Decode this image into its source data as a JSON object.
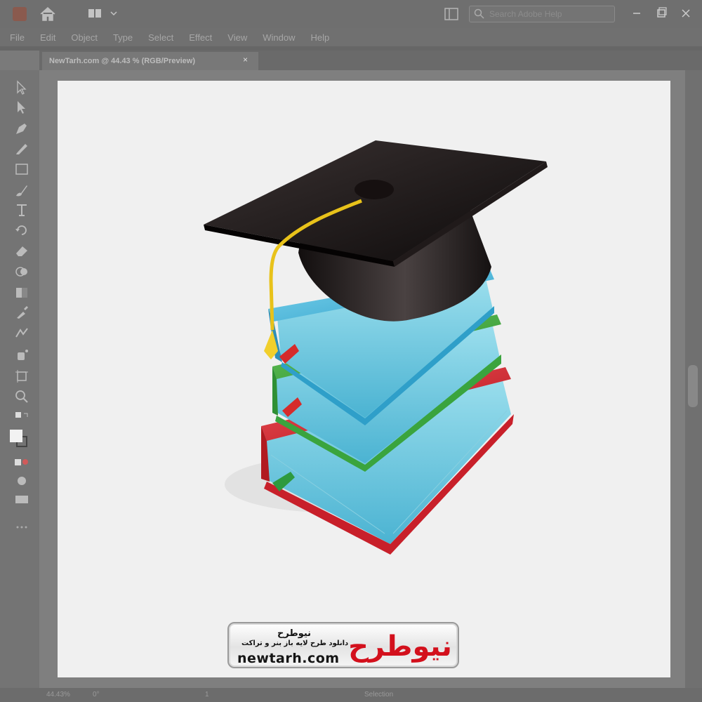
{
  "titlebar": {
    "search_placeholder": "Search Adobe Help",
    "icons": [
      "app-logo",
      "home-icon",
      "workspace-switcher-icon",
      "arrange-documents-icon",
      "search-icon",
      "minimize-icon",
      "maximize-icon",
      "close-icon"
    ]
  },
  "menu": [
    "File",
    "Edit",
    "Object",
    "Type",
    "Select",
    "Effect",
    "View",
    "Window",
    "Help"
  ],
  "tab": {
    "title": "NewTarh.com @ 44.43 % (RGB/Preview)",
    "close": "×"
  },
  "tools": [
    "selection-tool",
    "direct-selection-tool",
    "pen-tool",
    "pencil-tool",
    "rectangle-tool",
    "paintbrush-tool",
    "type-tool",
    "rotate-tool",
    "eraser-tool",
    "shape-builder-tool",
    "gradient-tool",
    "eyedropper-tool",
    "blend-tool",
    "symbol-sprayer-tool",
    "artboard-tool",
    "zoom-tool",
    "fill-stroke-swap",
    "fill-swatch",
    "color-mode",
    "drawing-mode",
    "screen-mode",
    "more-tools"
  ],
  "status": {
    "zoom": "44.43%",
    "rotation": "0°",
    "page": "1",
    "selection": "Selection"
  },
  "watermark": {
    "title_fa": "نیوطرح",
    "subtitle_fa": "دانلود طرح لایه باز بنر و تراکت",
    "domain": "newtarh.com",
    "logo_text": "نیوطرح"
  },
  "artwork": {
    "description_icons": [
      "graduation-cap-icon",
      "tassel-icon",
      "book-stack-icon"
    ],
    "colors": {
      "cap": "#1a1414",
      "tassel": "#e8c21a",
      "book_blue": "#5bc0dc",
      "book_green": "#4caf50",
      "book_red": "#d8232a",
      "bookmark_red": "#d52b2b",
      "bookmark_green": "#2e9a3e"
    }
  }
}
